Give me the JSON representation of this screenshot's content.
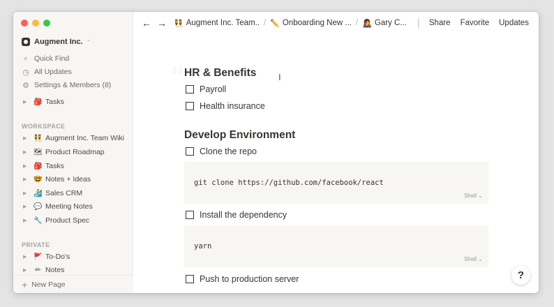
{
  "sidebar": {
    "workspace_name": "Augment Inc.",
    "nav": [
      {
        "icon": "search-icon",
        "glyph": "⌕",
        "label": "Quick Find"
      },
      {
        "icon": "clock-icon",
        "glyph": "◷",
        "label": "All Updates"
      },
      {
        "icon": "gear-icon",
        "glyph": "⚙",
        "label": "Settings & Members (8)"
      }
    ],
    "top_pages": [
      {
        "emoji": "🎒",
        "label": "Tasks"
      }
    ],
    "workspace_label": "WORKSPACE",
    "workspace_pages": [
      {
        "emoji": "👯",
        "label": "Augment Inc. Team Wiki"
      },
      {
        "emoji": "🗺",
        "label": "Product Roadmap"
      },
      {
        "emoji": "🎒",
        "label": "Tasks"
      },
      {
        "emoji": "🤓",
        "label": "Notes + Ideas"
      },
      {
        "emoji": "🏄",
        "label": "Sales CRM"
      },
      {
        "emoji": "💬",
        "label": "Meeting Notes"
      },
      {
        "emoji": "🔧",
        "label": "Product Spec"
      }
    ],
    "private_label": "PRIVATE",
    "private_pages": [
      {
        "emoji": "🚩",
        "label": "To-Do's"
      },
      {
        "emoji": "✏",
        "label": "Notes"
      }
    ],
    "new_page": "New Page"
  },
  "topbar": {
    "breadcrumbs": [
      {
        "emoji": "👯",
        "label": "Augment Inc. Team.."
      },
      {
        "emoji": "✏️",
        "label": "Onboarding New ..."
      },
      {
        "emoji": "👩‍🎤",
        "label": "Gary C..."
      }
    ],
    "share": "Share",
    "favorite": "Favorite",
    "updates": "Updates",
    "more": "•••"
  },
  "page": {
    "sections": [
      {
        "heading": "HR & Benefits"
      },
      {
        "heading": "Develop Environment"
      }
    ],
    "todos": [
      "Payroll",
      "Health insurance",
      "Clone the repo",
      "Install the dependency",
      "Push to production server"
    ],
    "code_blocks": [
      {
        "code": "git clone https://github.com/facebook/react",
        "language": "Shell ⌄"
      },
      {
        "code": "yarn",
        "language": "Shell ⌄"
      }
    ]
  },
  "help": "?"
}
